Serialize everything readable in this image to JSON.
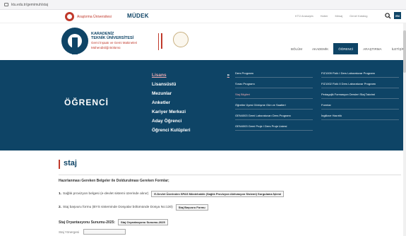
{
  "browser": {
    "url": "ktu.edu.tr/gemimuh/staj"
  },
  "topbar": {
    "anniversary": "Araştırma Üniversitesi",
    "mudek": "MÜDEK",
    "links": [
      "KTÜ Anasayfa",
      "Haber",
      "Mesaj",
      "Genel Katalog"
    ],
    "lang": "EN"
  },
  "header": {
    "uni_line1": "KARADENİZ",
    "uni_line2": "TEKNİK ÜNİVERSİTESİ",
    "dept_line1": "Gemi İnşaatı ve Gemi Makineleri",
    "dept_line2": "Mühendisliği Bölümü",
    "nav": [
      {
        "label": "BÖLÜM",
        "active": false
      },
      {
        "label": "AKADEMİK",
        "active": false
      },
      {
        "label": "ÖĞRENCİ",
        "active": true
      },
      {
        "label": "ARAŞTIRMA",
        "active": false
      },
      {
        "label": "İLETİŞİM",
        "active": false
      }
    ]
  },
  "band": {
    "title": "ÖĞRENCİ",
    "menu": [
      {
        "label": "Lisans",
        "active": true,
        "arrow": "»"
      },
      {
        "label": "Lisansüstü",
        "active": false,
        "arrow": ""
      },
      {
        "label": "Mezunlar",
        "active": false,
        "arrow": ""
      },
      {
        "label": "Anketler",
        "active": false,
        "arrow": ""
      },
      {
        "label": "Kariyer Merkezi",
        "active": false,
        "arrow": ""
      },
      {
        "label": "Aday Öğrenci",
        "active": false,
        "arrow": ""
      },
      {
        "label": "Öğrenci Kulüpleri",
        "active": false,
        "arrow": ""
      }
    ],
    "col2": [
      {
        "label": "Ders Programı",
        "active": false
      },
      {
        "label": "Sınav Programı",
        "active": false
      },
      {
        "label": "Staj Bilgileri",
        "active": true
      },
      {
        "label": "Öğretim Üyesi Görüşme Gün ve Saatleri",
        "active": false
      },
      {
        "label": "GEN4003 Gemi Laboratuvarı Ders Programı",
        "active": false
      },
      {
        "label": "GEN4003 Gemi Proje I Ders Proje Listesi",
        "active": false
      }
    ],
    "col3": [
      {
        "label": "FIZ1009 Fizik I Ders Laboratuvar Programı",
        "active": false
      },
      {
        "label": "FIZ1002 Fizik II Ders Laboratuvar Programı",
        "active": false
      },
      {
        "label": "Pedagojik Formasyon Dersleri Staj Takvimi",
        "active": false
      },
      {
        "label": "Formlar",
        "active": false
      },
      {
        "label": "İngilizce Hazırlık",
        "active": false
      }
    ]
  },
  "content": {
    "page_title": "staj",
    "requirements_heading": "Hazırlanması Gereken Belgeler ile Doldurulması Gereken Formlar;",
    "item1_num": "1.",
    "item1_text": "Sağlık provizyon belgesi (e-devlet sistemi üzerinde alınır)",
    "item1_button": "E-Devlet Üzerinden SPAS Müstehaklık (Sağlık Provizyon Aktivasyon Sistemi) Sorgulama İşlemi",
    "item2_num": "2.",
    "item2_text": "Staj başvuru formu (BYS sisteminde Dosyalar bölümünde Dosya No:130)",
    "item2_button": "Staj Başvuru Formu",
    "orientation_label": "Staj Oryantasyonu Sunumu-2025:",
    "orientation_button": "Staj Oryantasyonu Sunumu-2025",
    "next_label": "Staj Yönergesi"
  }
}
